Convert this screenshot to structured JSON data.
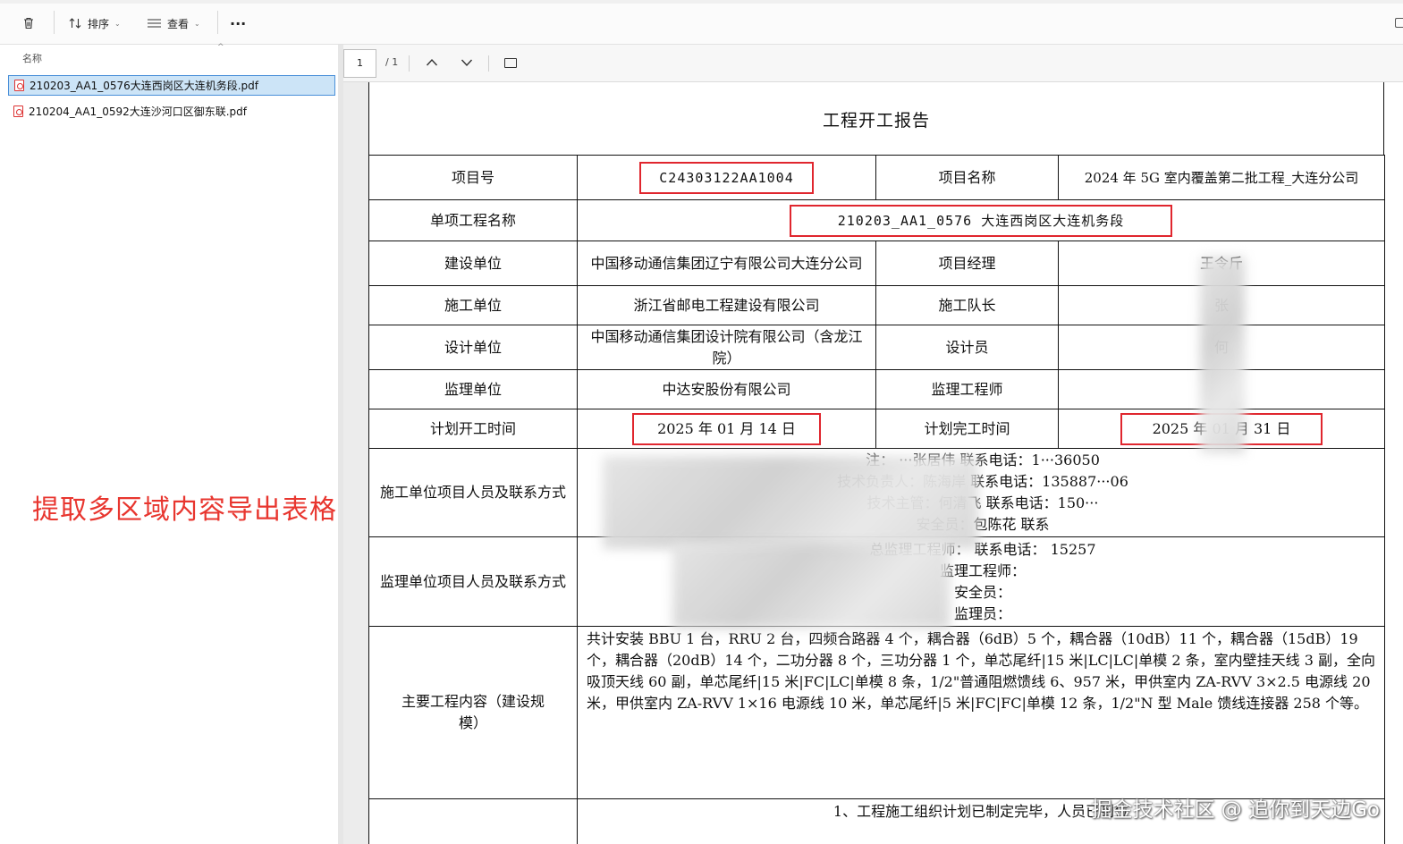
{
  "toolbar": {
    "sort_label": "排序",
    "view_label": "查看",
    "more_label": "···"
  },
  "file_pane": {
    "column_header": "名称",
    "files": [
      "210203_AA1_0576大连西岗区大连机务段.pdf",
      "210204_AA1_0592大连沙河口区御东联.pdf"
    ],
    "overlay_caption": "提取多区域内容导出表格"
  },
  "pdf_toolbar": {
    "page_value": "1",
    "page_total": "/ 1"
  },
  "document": {
    "title": "工程开工报告",
    "rows": {
      "project_no_label": "项目号",
      "project_no_value": "C24303122AA1004",
      "project_name_label": "项目名称",
      "project_name_value": "2024 年 5G 室内覆盖第二批工程_大连分公司",
      "sub_project_label": "单项工程名称",
      "sub_project_value": "210203_AA1_0576 大连西岗区大连机务段",
      "builder_label": "建设单位",
      "builder_value": "中国移动通信集团辽宁有限公司大连分公司",
      "pm_label": "项目经理",
      "pm_value": "王令斤",
      "contractor_label": "施工单位",
      "contractor_value": "浙江省邮电工程建设有限公司",
      "team_lead_label": "施工队长",
      "team_lead_value": "张",
      "design_unit_label": "设计单位",
      "design_unit_value": "中国移动通信集团设计院有限公司（含龙江院）",
      "designer_label": "设计员",
      "designer_value": "何",
      "supervisor_unit_label": "监理单位",
      "supervisor_unit_value": "中达安股份有限公司",
      "supervisor_engineer_label": "监理工程师",
      "supervisor_engineer_value": "",
      "plan_start_label": "计划开工时间",
      "plan_start_value": "2025 年 01 月 14 日",
      "plan_end_label": "计划完工时间",
      "plan_end_value": "2025 年 01 月 31 日",
      "contractor_staff_label": "施工单位项目人员及联系方式",
      "contractor_staff_lines": [
        "注：   ···张居伟    联系电话：1···36050",
        "技术负责人：陈海岸    联系电话：135887···06",
        "技术主管：何清飞    联系电话：150···",
        "安全员：包陈花          联系"
      ],
      "supervisor_staff_label": "监理单位项目人员及联系方式",
      "supervisor_staff_lines": [
        "总监理工程师：          联系电话：     15257",
        "监理工程师：",
        "安全员：",
        "监理员："
      ],
      "scope_label": "主要工程内容（建设规模）",
      "scope_text": "共计安装 BBU 1 台，RRU 2 台，四频合路器 4 个，耦合器（6dB）5 个，耦合器（10dB）11 个，耦合器（15dB）19 个，耦合器（20dB）14 个，二功分器 8 个，三功分器 1 个，单芯尾纤|15 米|LC|LC|单模 2 条，室内壁挂天线 3 副，全向吸顶天线 60 副，单芯尾纤|15 米|FC|LC|单模 8 条，1/2\"普通阻燃馈线 6、957 米，甲供室内 ZA-RVV 3×2.5 电源线 20 米，甲供室内 ZA-RVV 1×16 电源线 10 米，单芯尾纤|5 米|FC|FC|单模 12 条，1/2\"N 型 Male 馈线连接器 258 个等。",
      "prep_text": "1、工程施工组织计划已制定完毕，人员已到位"
    }
  },
  "watermark": "掘金技术社区 @ 追你到天边Go",
  "colors": {
    "highlight": "#e0262e",
    "selection": "#cce4f7",
    "caption": "#e8362f"
  }
}
